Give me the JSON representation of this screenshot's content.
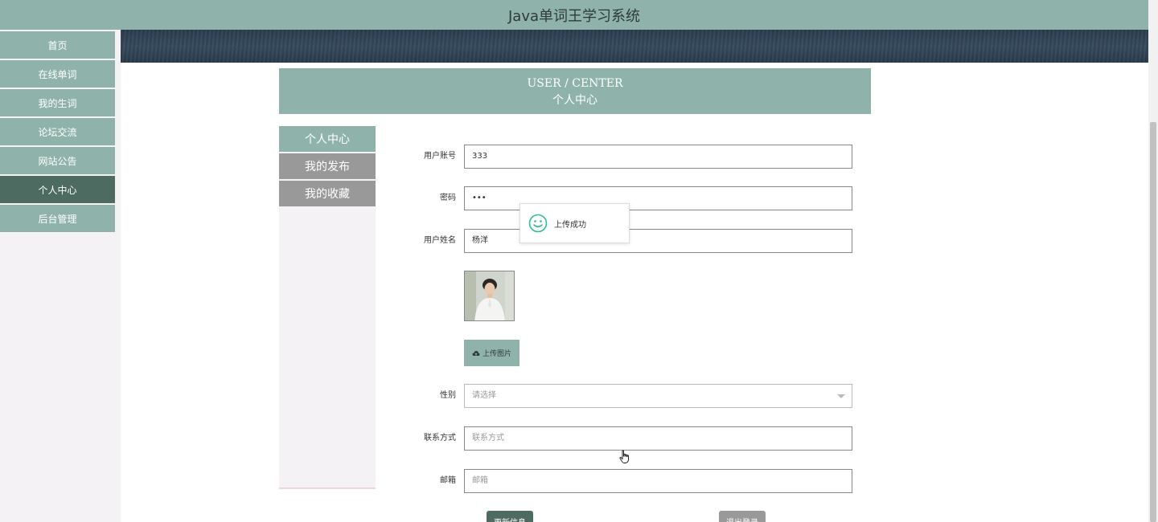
{
  "app": {
    "title": "Java单词王学习系统"
  },
  "sidebar": {
    "items": [
      {
        "label": "首页",
        "active": false
      },
      {
        "label": "在线单词",
        "active": false
      },
      {
        "label": "我的生词",
        "active": false
      },
      {
        "label": "论坛交流",
        "active": false
      },
      {
        "label": "网站公告",
        "active": false
      },
      {
        "label": "个人中心",
        "active": true
      },
      {
        "label": "后台管理",
        "active": false
      }
    ]
  },
  "section": {
    "title_en": "USER / CENTER",
    "title_cn": "个人中心"
  },
  "subnav": {
    "tabs": [
      {
        "label": "个人中心",
        "active": true
      },
      {
        "label": "我的发布",
        "active": false
      },
      {
        "label": "我的收藏",
        "active": false
      }
    ]
  },
  "form": {
    "account": {
      "label": "用户账号",
      "value": "333"
    },
    "password": {
      "label": "密码",
      "value": "•••"
    },
    "name": {
      "label": "用户姓名",
      "value": "杨洋"
    },
    "upload": {
      "label": "上传图片",
      "icon": "cloud-upload-icon"
    },
    "gender": {
      "label": "性别",
      "placeholder": "请选择"
    },
    "contact": {
      "label": "联系方式",
      "placeholder": "联系方式"
    },
    "email": {
      "label": "邮箱",
      "placeholder": "邮箱"
    }
  },
  "toast": {
    "message": "上传成功",
    "icon": "smile-icon",
    "color": "#2bbf8a"
  },
  "actions": {
    "update_label": "更新信息",
    "logout_label": "退出登录"
  },
  "colors": {
    "primary": "#8fb3aa",
    "active": "#4d6b60",
    "inactive": "#999999"
  }
}
